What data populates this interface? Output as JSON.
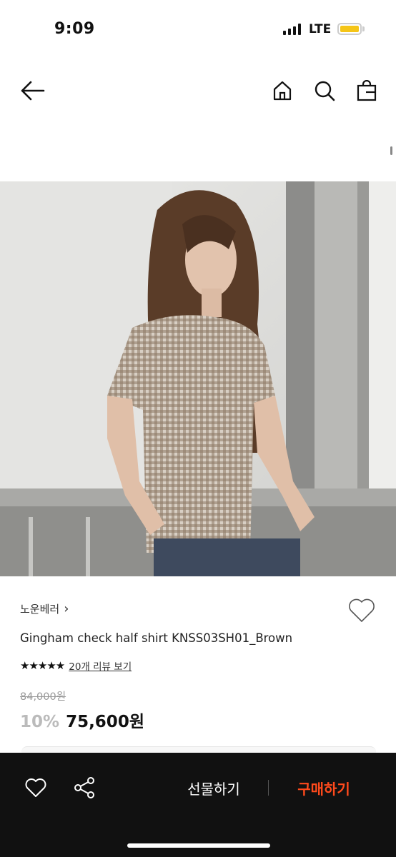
{
  "status": {
    "time": "9:09",
    "network": "LTE"
  },
  "brand": {
    "name": "노운베러",
    "chevron": "›"
  },
  "product": {
    "name": "Gingham check half shirt KNSS03SH01_Brown",
    "stars": "★★★★★",
    "review_link": "20개 리뷰 보기",
    "original_price": "84,000원",
    "discount": "10%",
    "sale_price": "75,600원"
  },
  "actions": {
    "gift_label": "선물하기",
    "buy_label": "구매하기"
  },
  "colors": {
    "buy_accent": "#ff4a1c",
    "battery": "#f5c518",
    "bottom_bar": "#111111"
  },
  "icons": {
    "back": "back-arrow-icon",
    "home": "home-icon",
    "search": "search-icon",
    "bag": "shopping-bag-icon",
    "wishlist": "heart-icon",
    "share": "share-icon"
  }
}
